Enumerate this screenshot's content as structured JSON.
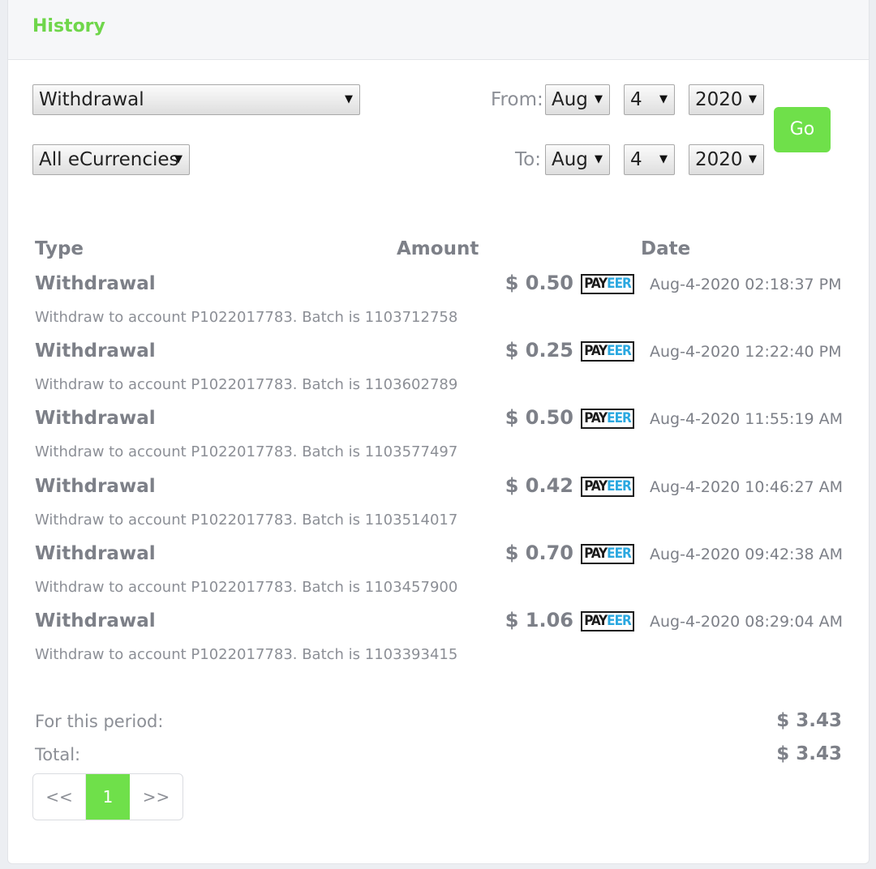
{
  "header": {
    "title": "History"
  },
  "filters": {
    "type_select": "Withdrawal",
    "currency_select": "All eCurrencies",
    "from_label": "From:",
    "to_label": "To:",
    "from": {
      "month": "Aug",
      "day": "4",
      "year": "2020"
    },
    "to": {
      "month": "Aug",
      "day": "4",
      "year": "2020"
    },
    "go_label": "Go",
    "arrow": "▼"
  },
  "table": {
    "headers": {
      "type": "Type",
      "amount": "Amount",
      "date": "Date"
    },
    "rows": [
      {
        "type": "Withdrawal",
        "amount": "$ 0.50",
        "date": "Aug-4-2020 02:18:37 PM",
        "desc": "Withdraw to account P1022017783. Batch is 1103712758"
      },
      {
        "type": "Withdrawal",
        "amount": "$ 0.25",
        "date": "Aug-4-2020 12:22:40 PM",
        "desc": "Withdraw to account P1022017783. Batch is 1103602789"
      },
      {
        "type": "Withdrawal",
        "amount": "$ 0.50",
        "date": "Aug-4-2020 11:55:19 AM",
        "desc": "Withdraw to account P1022017783. Batch is 1103577497"
      },
      {
        "type": "Withdrawal",
        "amount": "$ 0.42",
        "date": "Aug-4-2020 10:46:27 AM",
        "desc": "Withdraw to account P1022017783. Batch is 1103514017"
      },
      {
        "type": "Withdrawal",
        "amount": "$ 0.70",
        "date": "Aug-4-2020 09:42:38 AM",
        "desc": "Withdraw to account P1022017783. Batch is 1103457900"
      },
      {
        "type": "Withdrawal",
        "amount": "$ 1.06",
        "date": "Aug-4-2020 08:29:04 AM",
        "desc": "Withdraw to account P1022017783. Batch is 1103393415"
      }
    ],
    "logo": {
      "pay": "PAY",
      "eer": "EER"
    }
  },
  "summary": {
    "period_label": "For this period:",
    "period_value": "$ 3.43",
    "total_label": "Total:",
    "total_value": "$ 3.43"
  },
  "pagination": {
    "prev": "<<",
    "current": "1",
    "next": ">>"
  },
  "colors": {
    "accent": "#6fe04a",
    "title": "#6fd64b",
    "payeer_blue": "#2ba8e0"
  }
}
